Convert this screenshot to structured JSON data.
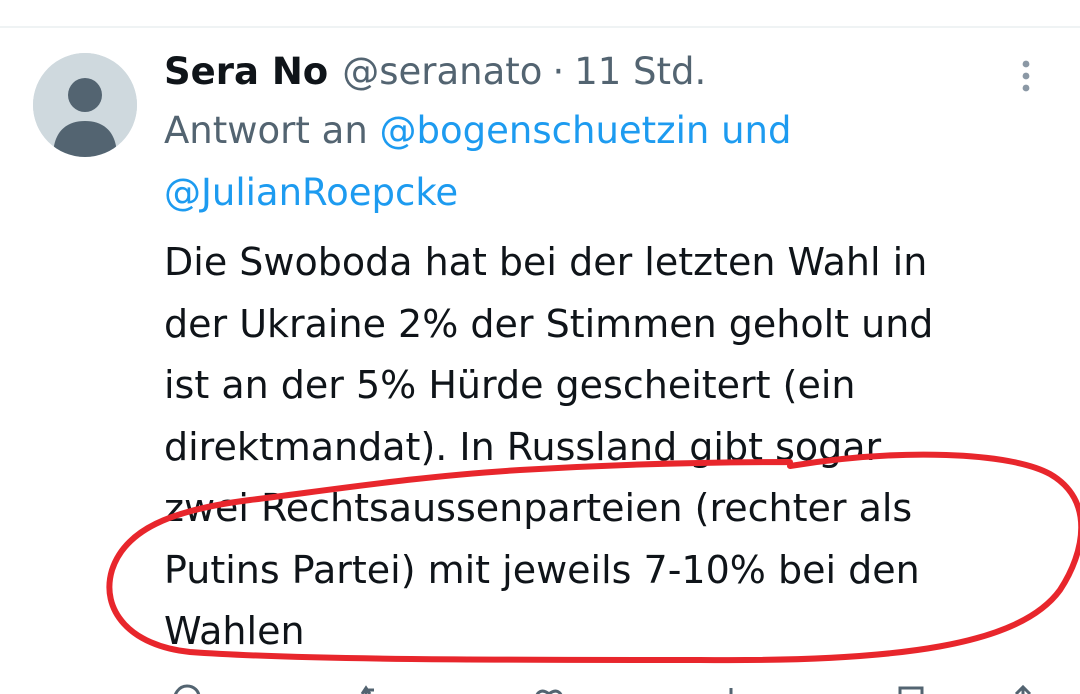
{
  "tweet": {
    "author_name": "Sera No",
    "author_handle": "@seranato",
    "separator": "·",
    "time": "11 Std.",
    "reply_prefix": "Antwort an",
    "reply_mention_1": "@bogenschuetzin",
    "reply_joiner": "und",
    "reply_mention_2": "@JulianRoepcke",
    "text_lines": [
      "Die Swoboda hat bei der letzten Wahl in",
      "der Ukraine 2% der Stimmen geholt und",
      "ist an der 5% Hürde gescheitert (ein",
      "direktmandat). In Russland gibt sogar",
      "zwei Rechtsaussenparteien (rechter als",
      "Putins Partei) mit jeweils 7-10% bei den",
      "Wahlen"
    ]
  },
  "icons": {
    "avatar": "default-avatar-icon",
    "more": "more-options-icon",
    "actions": [
      "reply-icon",
      "repost-icon",
      "like-icon",
      "views-icon",
      "bookmark-icon",
      "share-icon"
    ]
  },
  "colors": {
    "text": "#0f1419",
    "muted": "#536471",
    "mention": "#1d9bf0",
    "annotation": "#e8262c",
    "avatar_bg": "#cfd9de",
    "avatar_fg": "#536471"
  }
}
